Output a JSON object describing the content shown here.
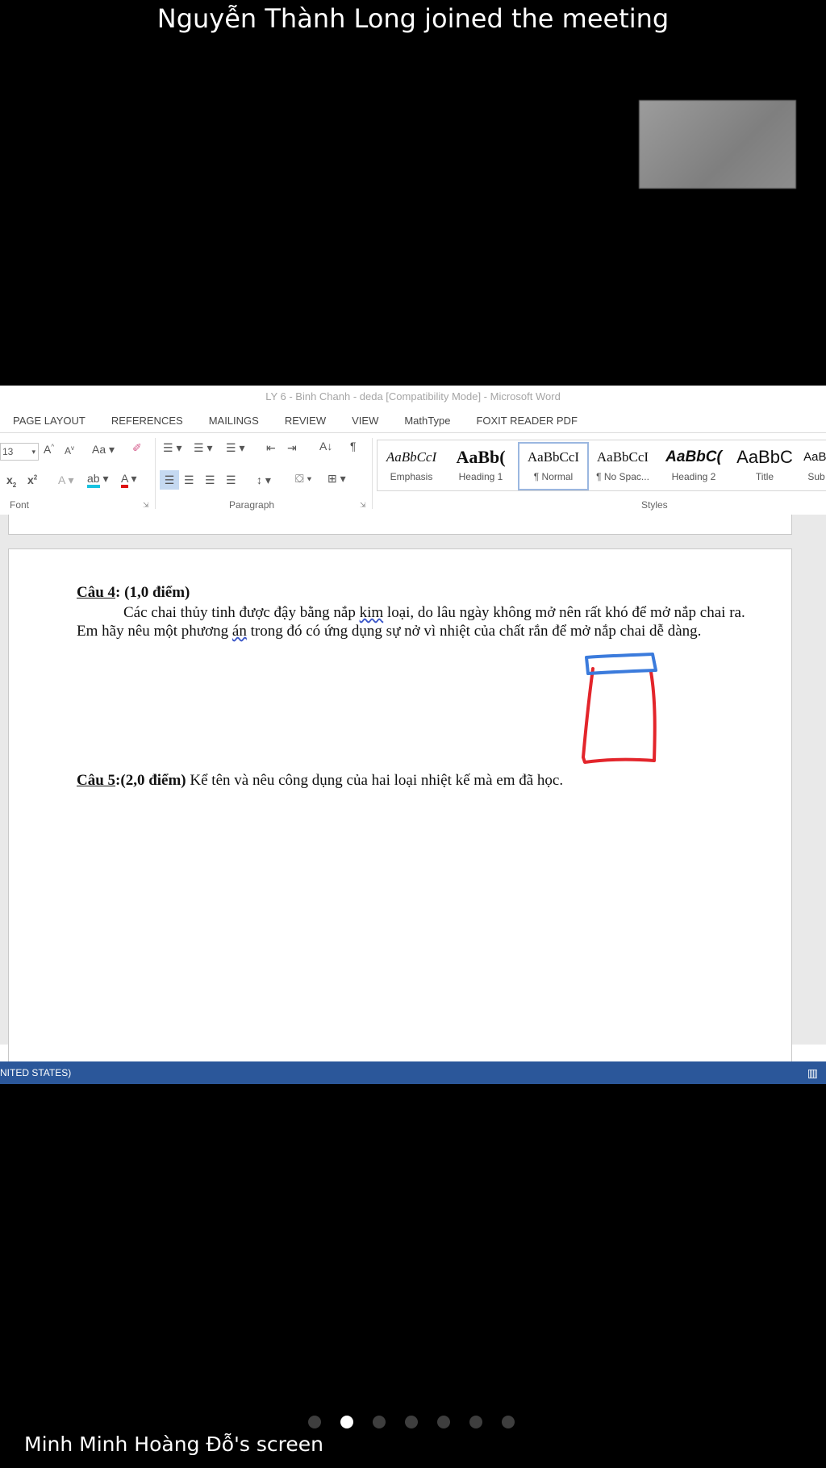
{
  "notification": "Nguyễn Thành Long joined the meeting",
  "word": {
    "title": "LY 6 - Binh Chanh - deda [Compatibility Mode] - Microsoft Word",
    "tabs": [
      "PAGE LAYOUT",
      "REFERENCES",
      "MAILINGS",
      "REVIEW",
      "VIEW",
      "MathType",
      "FOXIT READER PDF"
    ],
    "font_size": "13",
    "groups": {
      "font": "Font",
      "paragraph": "Paragraph",
      "styles": "Styles"
    },
    "styles": [
      {
        "sample": "AaBbCcI",
        "name": "Emphasis"
      },
      {
        "sample": "AaBb(",
        "name": "Heading 1"
      },
      {
        "sample": "AaBbCcI",
        "name": "¶ Normal"
      },
      {
        "sample": "AaBbCcI",
        "name": "¶ No Spac..."
      },
      {
        "sample": "AaBbC(",
        "name": "Heading 2"
      },
      {
        "sample": "AaBbC",
        "name": "Title"
      },
      {
        "sample": "AaBl",
        "name": "Sub"
      }
    ],
    "document": {
      "q4_label": "Câu 4",
      "q4_points": ": (1,0 điểm)",
      "q4_p1": "Các chai thủy tinh được đậy bằng nắp ",
      "q4_kim": "kim",
      "q4_p2": " loại, do lâu ngày không mở nên rất khó để mở nắp chai ra. Em hãy nêu một phương ",
      "q4_an": "án",
      "q4_p3": " trong đó có ứng dụng sự nở vì nhiệt của chất rắn để mở nắp chai dễ dàng.",
      "q5_label": "Câu 5",
      "q5_points": ":(2,0 điểm)",
      "q5_text": " Kể tên và nêu công dụng của hai loại nhiệt kế mà em đã học."
    },
    "status_language": "NITED STATES)"
  },
  "annotation_colors": {
    "cap": "#3b7bdc",
    "bottle": "#e3252b"
  },
  "page_dots": {
    "count": 7,
    "active": 1
  },
  "screen_label": "Minh Minh Hoàng Đỗ's screen"
}
